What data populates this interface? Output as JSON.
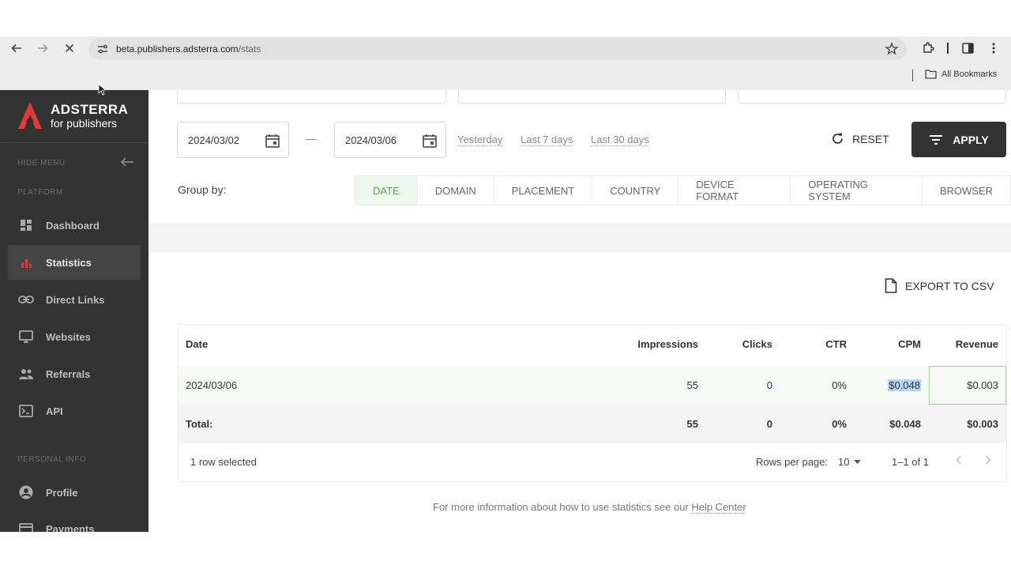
{
  "browser": {
    "url_host": "beta.publishers.adsterra.com",
    "url_path": "/stats",
    "bookmarks_label": "All Bookmarks"
  },
  "sidebar": {
    "logo_line1": "ADSTERRA",
    "logo_line2": "for publishers",
    "hide_menu": "HIDE MENU",
    "section_platform": "PLATFORM",
    "section_personal": "PERSONAL INFO",
    "items": [
      {
        "label": "Dashboard",
        "icon": "dashboard-icon"
      },
      {
        "label": "Statistics",
        "icon": "bar-chart-icon",
        "active": true
      },
      {
        "label": "Direct Links",
        "icon": "link-icon"
      },
      {
        "label": "Websites",
        "icon": "monitor-icon"
      },
      {
        "label": "Referrals",
        "icon": "people-icon"
      },
      {
        "label": "API",
        "icon": "terminal-icon"
      }
    ],
    "personal_items": [
      {
        "label": "Profile",
        "icon": "account-circle-icon"
      },
      {
        "label": "Payments",
        "icon": "credit-card-icon"
      }
    ]
  },
  "filters": {
    "date_from": "2024/03/02",
    "date_to": "2024/03/06",
    "quick_yesterday": "Yesterday",
    "quick_7": "Last 7 days",
    "quick_30": "Last 30 days",
    "reset_label": "RESET",
    "apply_label": "APPLY"
  },
  "groupby": {
    "label": "Group by:",
    "tabs": [
      "DATE",
      "DOMAIN",
      "PLACEMENT",
      "COUNTRY",
      "DEVICE FORMAT",
      "OPERATING SYSTEM",
      "BROWSER"
    ],
    "active": "DATE"
  },
  "export_label": "EXPORT TO CSV",
  "table": {
    "headers": {
      "date": "Date",
      "impressions": "Impressions",
      "clicks": "Clicks",
      "ctr": "CTR",
      "cpm": "CPM",
      "revenue": "Revenue"
    },
    "rows": [
      {
        "date": "2024/03/06",
        "impressions": "55",
        "clicks": "0",
        "ctr": "0%",
        "cpm": "$0.048",
        "revenue": "$0.003"
      }
    ],
    "total": {
      "label": "Total:",
      "impressions": "55",
      "clicks": "0",
      "ctr": "0%",
      "cpm": "$0.048",
      "revenue": "$0.003"
    },
    "footer": {
      "selected": "1 row selected",
      "rows_per_page_label": "Rows per page:",
      "rows_per_page": "10",
      "range": "1–1 of 1"
    }
  },
  "help_text": "For more information about how to use statistics see our ",
  "help_link": "Help Center",
  "colors": {
    "sidebar_bg": "#333333",
    "accent_green": "#4caf50",
    "logo_red": "#e53935",
    "apply_bg": "#333333"
  }
}
